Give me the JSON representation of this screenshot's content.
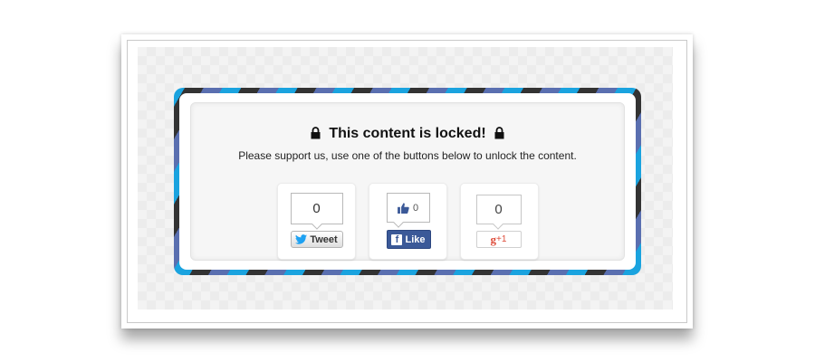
{
  "locker": {
    "title": "This content is locked!",
    "subtitle": "Please support us, use one of the buttons below to unlock the content.",
    "stripe_colors": [
      "#1aa3df",
      "#5a6fb0",
      "#333333"
    ]
  },
  "buttons": {
    "twitter": {
      "count": "0",
      "label": "Tweet",
      "icon": "twitter-bird-icon",
      "color": "#1da1f2"
    },
    "facebook": {
      "count": "0",
      "label": "Like",
      "icon": "facebook-logo-icon",
      "color": "#3b5998"
    },
    "google": {
      "count": "0",
      "label_g": "g",
      "label_plus": "+1",
      "icon": "google-plus-icon",
      "color": "#dd4b39"
    }
  }
}
